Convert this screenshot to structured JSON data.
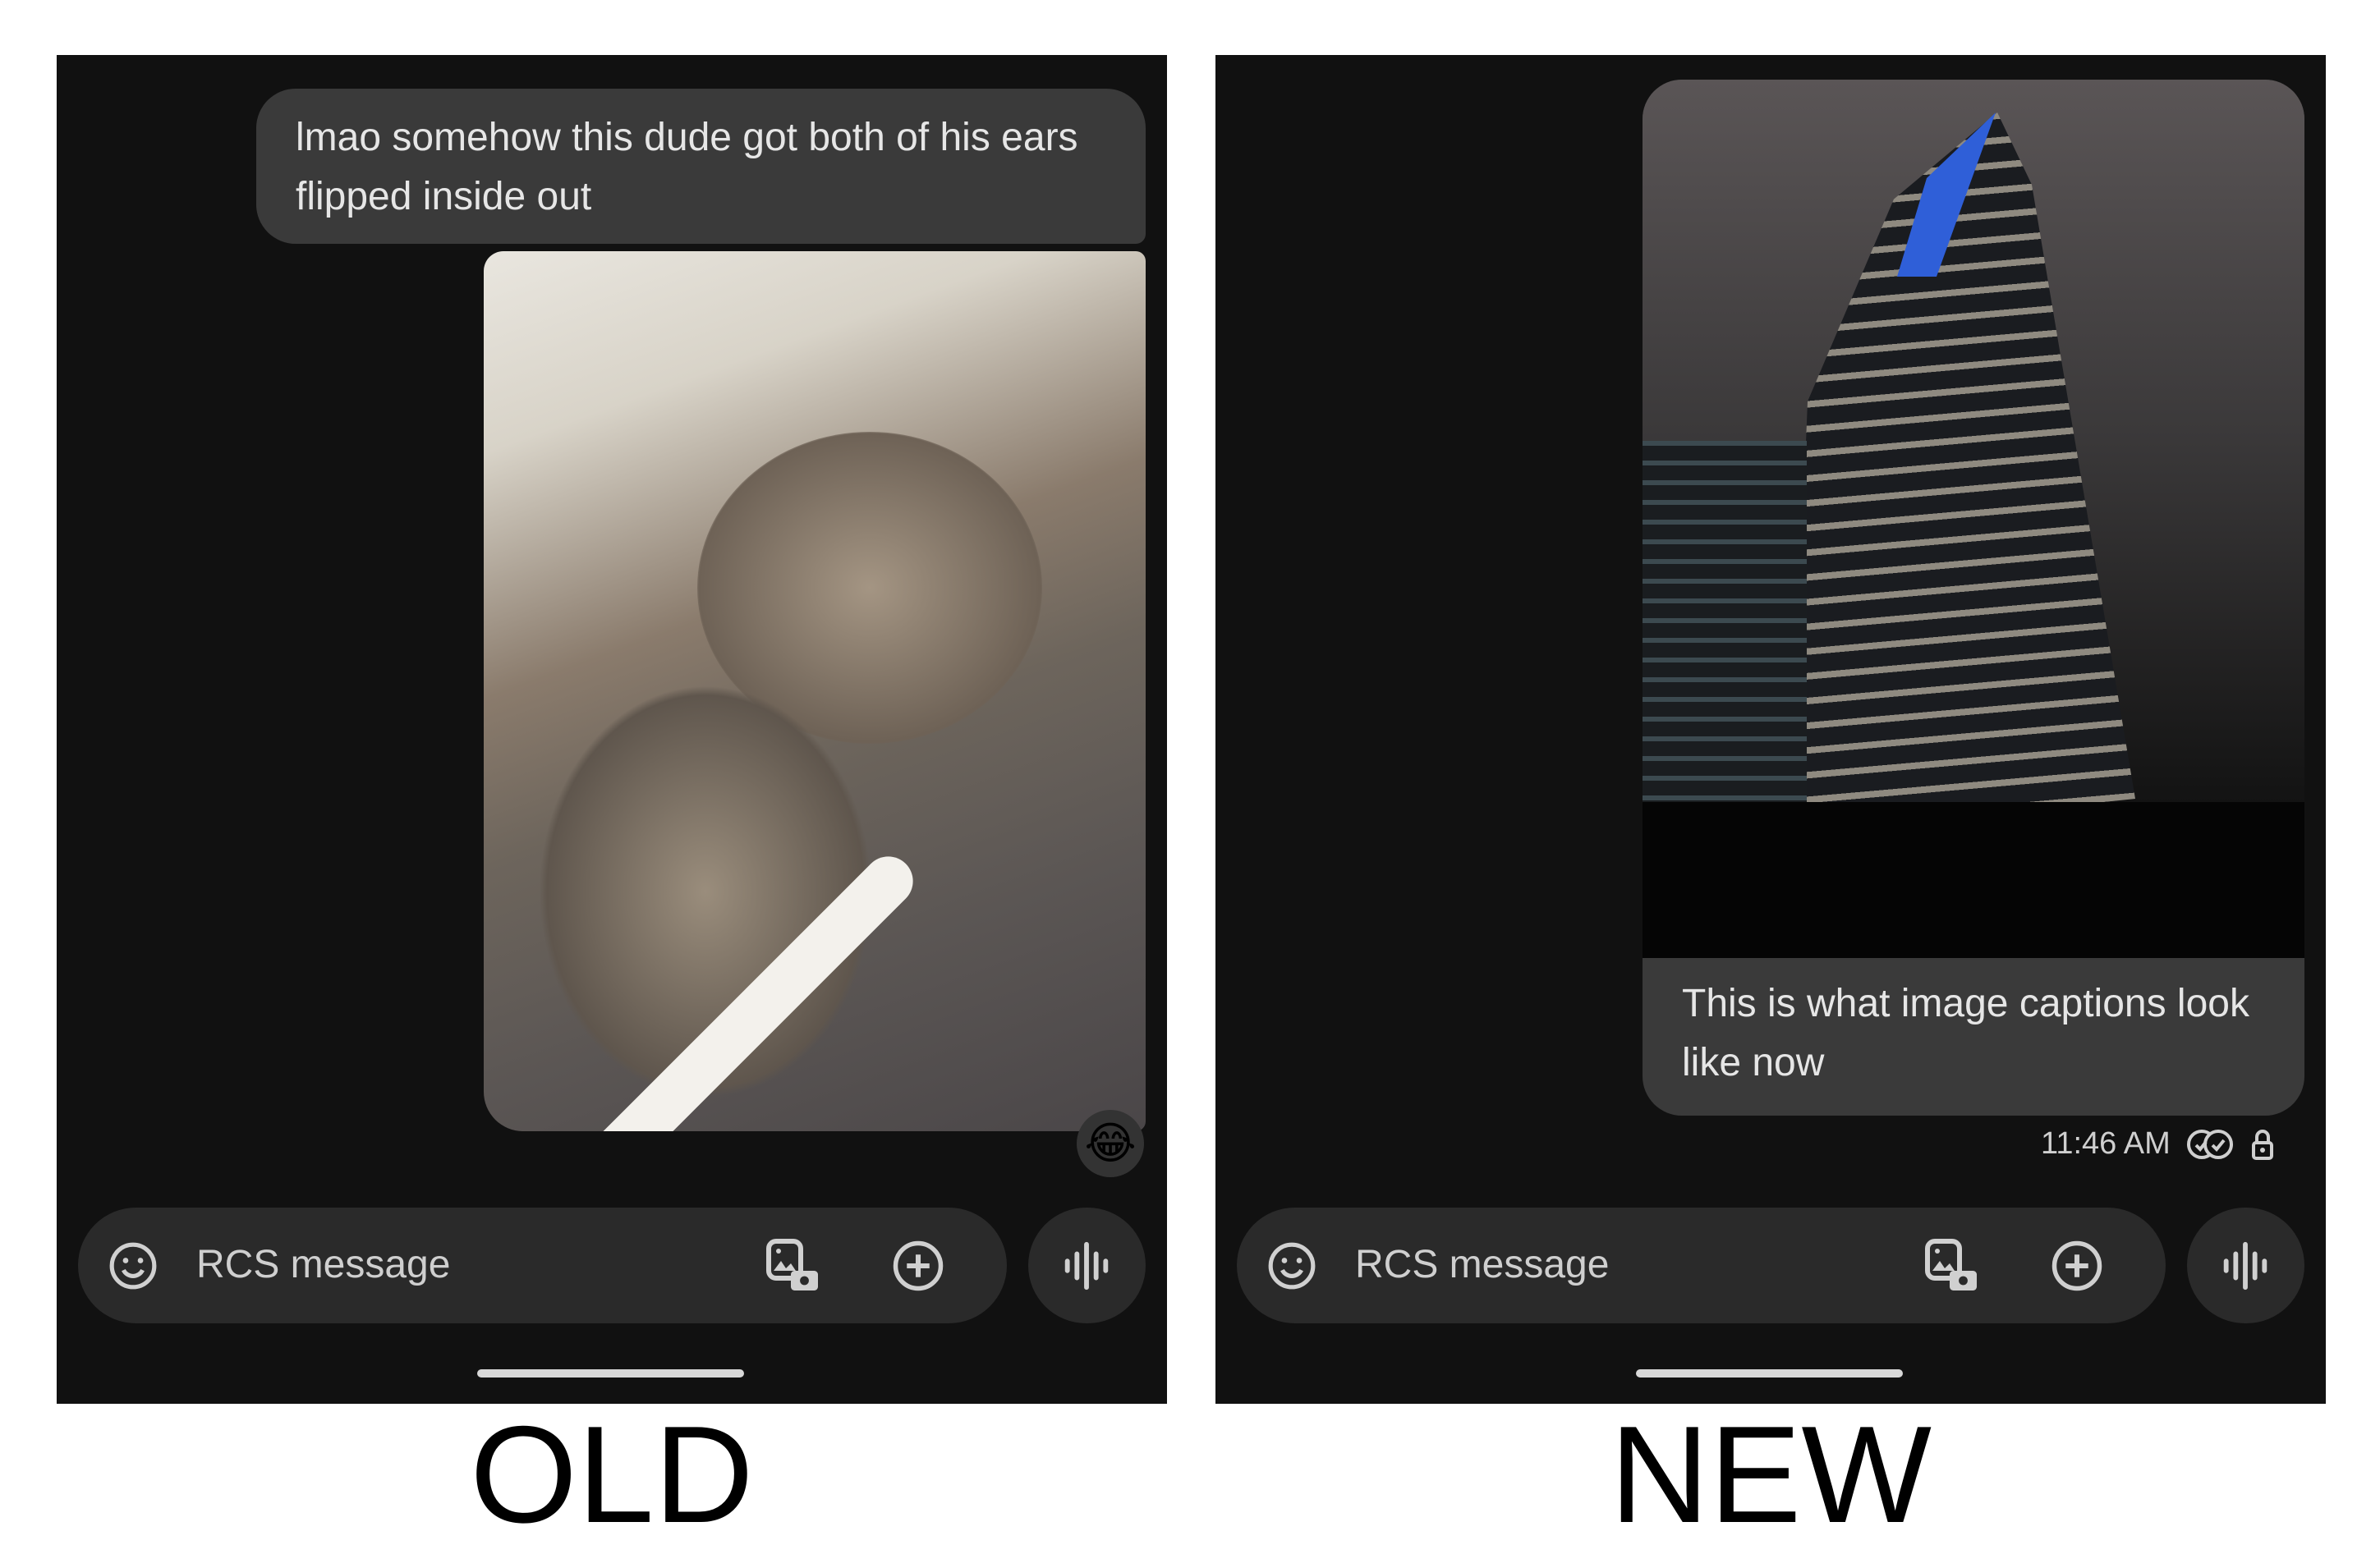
{
  "old": {
    "label": "OLD",
    "message": "lmao somehow this dude got both of his ears flipped inside out",
    "image": "cat photo",
    "reaction": "😂",
    "input": {
      "placeholder": "RCS message"
    }
  },
  "new": {
    "label": "NEW",
    "caption": "This is what image captions look like now",
    "image": "building photo",
    "timestamp": "11:46 AM",
    "status_icons": [
      "read-receipt-icon",
      "lock-icon"
    ],
    "input": {
      "placeholder": "RCS message"
    }
  },
  "colors": {
    "background": "#111111",
    "bubble": "#3a3a3a",
    "input": "#2a2a2a",
    "icon": "#d0d0d0"
  }
}
